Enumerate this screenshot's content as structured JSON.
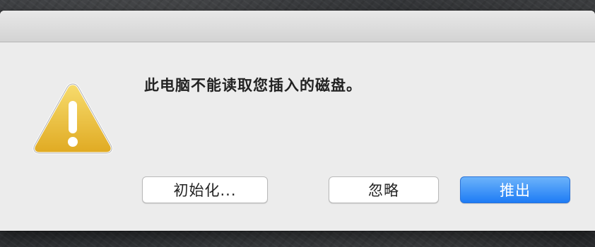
{
  "dialog": {
    "message": "此电脑不能读取您插入的磁盘。",
    "icon": "warning-icon"
  },
  "buttons": {
    "initialize_label": "初始化...",
    "ignore_label": "忽略",
    "eject_label": "推出"
  },
  "colors": {
    "dialog_background": "#ececec",
    "warning_yellow": "#f0c030",
    "primary_blue": "#1e7cf5"
  }
}
